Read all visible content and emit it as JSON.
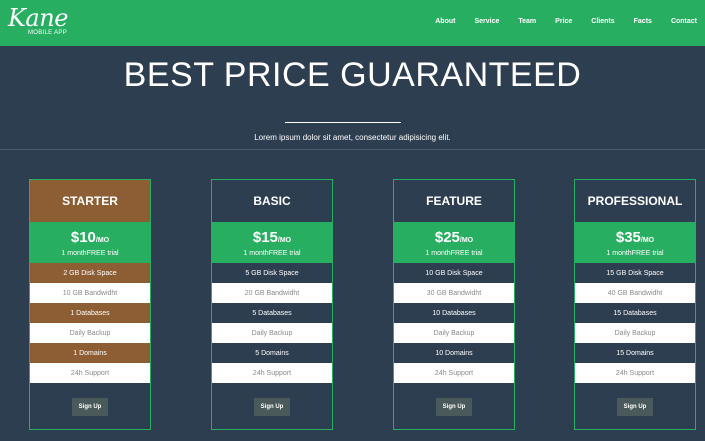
{
  "brand": {
    "name": "Kane",
    "tagline": "MOBILE APP"
  },
  "nav": [
    "About",
    "Service",
    "Team",
    "Price",
    "Clients",
    "Facts",
    "Contact"
  ],
  "section": {
    "title": "BEST PRICE GUARANTEED",
    "subtitle": "Lorem ipsum dolor sit amet, consectetur adipisicing elit."
  },
  "plans": [
    {
      "name": "STARTER",
      "price": "$10",
      "per": "/MO",
      "trial": "1 monthFREE trial",
      "features": [
        "2 GB Disk Space",
        "10 GB Bandwidht",
        "1 Databases",
        "Daily Backup",
        "1 Domains",
        "24h Support"
      ],
      "button": "Sign Up"
    },
    {
      "name": "BASIC",
      "price": "$15",
      "per": "/MO",
      "trial": "1 monthFREE trial",
      "features": [
        "5 GB Disk Space",
        "20 GB Bandwidht",
        "5 Databases",
        "Daily Backup",
        "5 Domains",
        "24h Support"
      ],
      "button": "Sign Up"
    },
    {
      "name": "FEATURE",
      "price": "$25",
      "per": "/MO",
      "trial": "1 monthFREE trial",
      "features": [
        "10 GB Disk Space",
        "30 GB Bandwidht",
        "10 Databases",
        "Daily Backup",
        "10 Domains",
        "24h Support"
      ],
      "button": "Sign Up"
    },
    {
      "name": "PROFESSIONAL",
      "price": "$35",
      "per": "/MO",
      "trial": "1 monthFREE trial",
      "features": [
        "15 GB Disk Space",
        "40 GB Bandwidht",
        "15 Databases",
        "Daily Backup",
        "15 Domains",
        "24h Support"
      ],
      "button": "Sign Up"
    }
  ],
  "colors": {
    "brand_green": "#27ae60",
    "background": "#2d3e50",
    "highlight_brown": "#8d5e34",
    "button": "#4a5a5a"
  }
}
